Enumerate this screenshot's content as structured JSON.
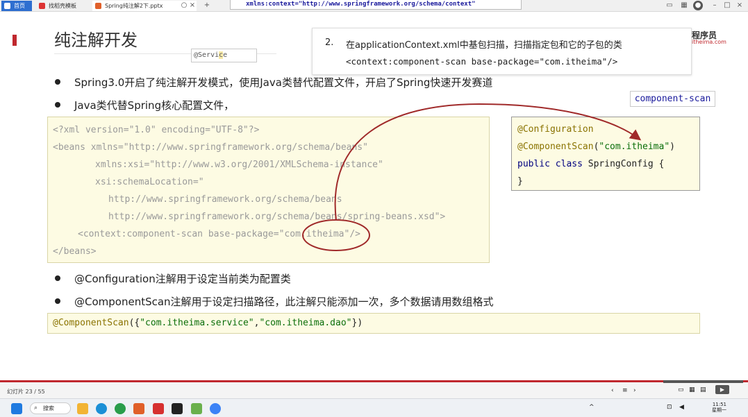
{
  "browser": {
    "tabs": [
      {
        "label": "首页",
        "active": true
      },
      {
        "label": "找稻壳模板"
      },
      {
        "label": "Spring纯注解2下.pptx"
      }
    ],
    "xmlns_popup": "xmlns:context=\"http://www.springframework.org/schema/context\""
  },
  "slide": {
    "title": "纯注解开发",
    "brand_line1": "程序员",
    "brand_line2": "itheima.com",
    "service_box": {
      "prefix": "@Servi",
      "highlight": "c",
      "suffix": "e"
    },
    "callout": {
      "number": "2.",
      "line1": "在applicationContext.xml中基包扫描，扫描指定包和它的子包的类",
      "line2": "<context:component-scan base-package=\"com.itheima\"/>"
    },
    "component_scan_label": "component-scan",
    "bullets": [
      "Spring3.0开启了纯注解开发模式，使用Java类替代配置文件，开启了Spring快速开发赛道",
      "Java类代替Spring核心配置文件，",
      "@Configuration注解用于设定当前类为配置类",
      "@ComponentScan注解用于设定扫描路径，此注解只能添加一次，多个数据请用数组格式"
    ],
    "xml_code": [
      "<?xml version=\"1.0\" encoding=\"UTF-8\"?>",
      "<beans xmlns=\"http://www.springframework.org/schema/beans\"",
      "xmlns:xsi=\"http://www.w3.org/2001/XMLSchema-instance\"",
      "xsi:schemaLocation=\"",
      "http://www.springframework.org/schema/beans",
      "http://www.springframework.org/schema/beans/spring-beans.xsd\">",
      "<context:component-scan base-package=\"com.itheima\"/>",
      "</beans>"
    ],
    "java_code": {
      "ann1": "@Configuration",
      "ann2": "@ComponentScan",
      "ann2_arg_open": "(",
      "ann2_arg": "\"com.itheima\"",
      "ann2_arg_close": ")",
      "kw_public": "public",
      "kw_class": "class",
      "class_name": "SpringConfig {",
      "close": "}"
    },
    "array_code": {
      "ann": "@ComponentScan",
      "open": "({",
      "s1": "\"com.itheima.service\"",
      "comma": ",",
      "s2": "\"com.itheima.dao\"",
      "close": "})"
    }
  },
  "statusbar": {
    "page": "幻灯片 23 / 55"
  },
  "taskbar": {
    "search": "搜索",
    "time": "11:51",
    "date": "星期一"
  },
  "colors": {
    "accent_red": "#c0282e",
    "code_bg": "#fdfbe3",
    "arrow": "#a02a2a"
  }
}
